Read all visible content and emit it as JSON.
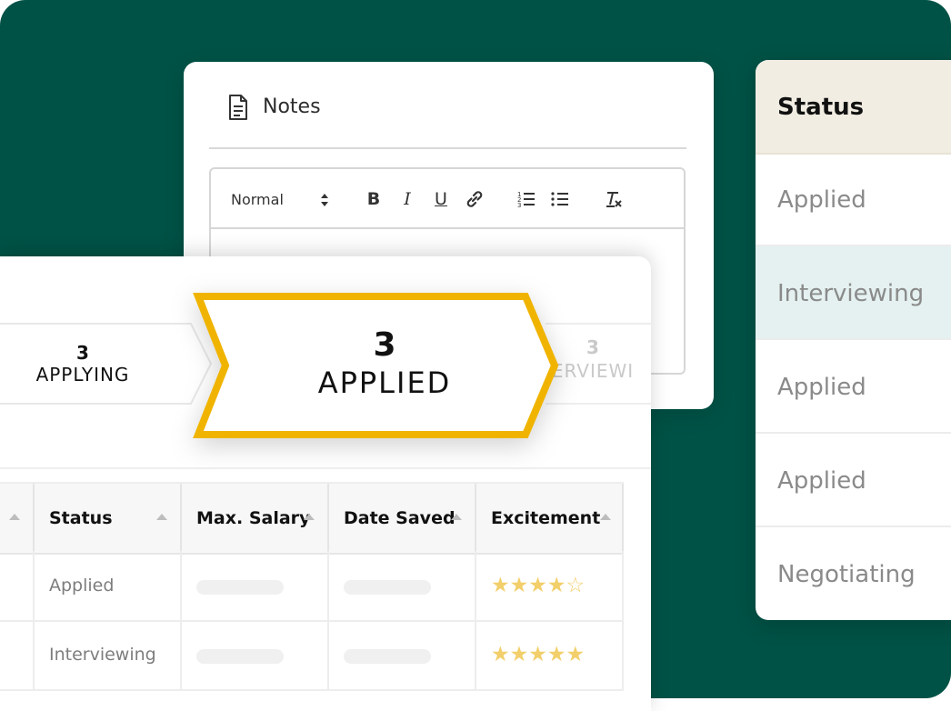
{
  "notes": {
    "title": "Notes",
    "toolbar": {
      "format_select": "Normal",
      "bold": "B",
      "italic": "I",
      "underline": "U"
    }
  },
  "status_card": {
    "header": "Status",
    "rows": [
      {
        "label": "Applied",
        "highlighted": false
      },
      {
        "label": "Interviewing",
        "highlighted": true
      },
      {
        "label": "Applied",
        "highlighted": false
      },
      {
        "label": "Applied",
        "highlighted": false
      },
      {
        "label": "Negotiating",
        "highlighted": false
      }
    ]
  },
  "pipeline": {
    "stages": [
      {
        "count": "3",
        "label": "APPLYING"
      },
      {
        "count": "3",
        "label": "APPLIED",
        "active": true
      },
      {
        "count": "3",
        "label": "ERVIEWI"
      }
    ]
  },
  "table": {
    "columns": [
      "Status",
      "Max. Salary",
      "Date Saved",
      "Excitement"
    ],
    "rows": [
      {
        "status": "Applied",
        "excitement": 4,
        "excitement_max": 5
      },
      {
        "status": "Interviewing",
        "excitement": 5,
        "excitement_max": 5
      }
    ]
  },
  "colors": {
    "background": "#005246",
    "accent_chevron": "#f0b400",
    "star": "#f2cf6b",
    "status_header": "#f1ede3",
    "highlight_row": "#e4f1f0"
  },
  "icons": [
    "document-icon",
    "updown-icon",
    "link-icon",
    "ordered-list-icon",
    "bullet-list-icon",
    "clear-format-icon",
    "sort-caret-icon",
    "star-icon"
  ]
}
